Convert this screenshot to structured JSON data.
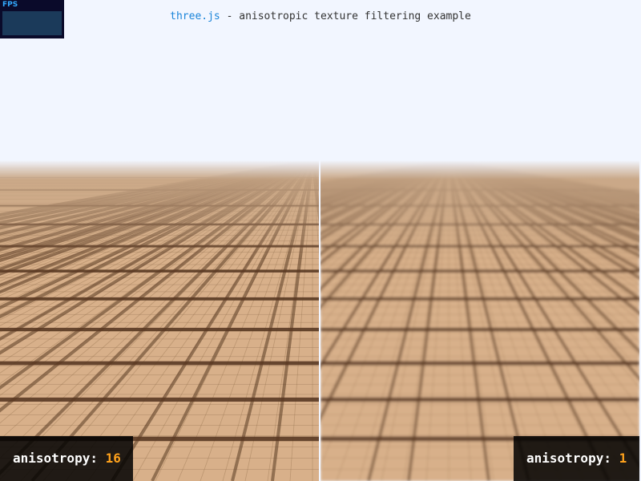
{
  "info": {
    "link_text": "three.js",
    "rest": " - anisotropic texture filtering example"
  },
  "fps": {
    "label": "FPS"
  },
  "left": {
    "label": "anisotropy: ",
    "value": "16"
  },
  "right": {
    "label": "anisotropy: ",
    "value": "1"
  },
  "colors": {
    "background": "#f2f6ff",
    "wood": "#d8b08a",
    "seam": "#5a3a24",
    "accent": "#ffa21c",
    "link": "#1a84d9"
  }
}
